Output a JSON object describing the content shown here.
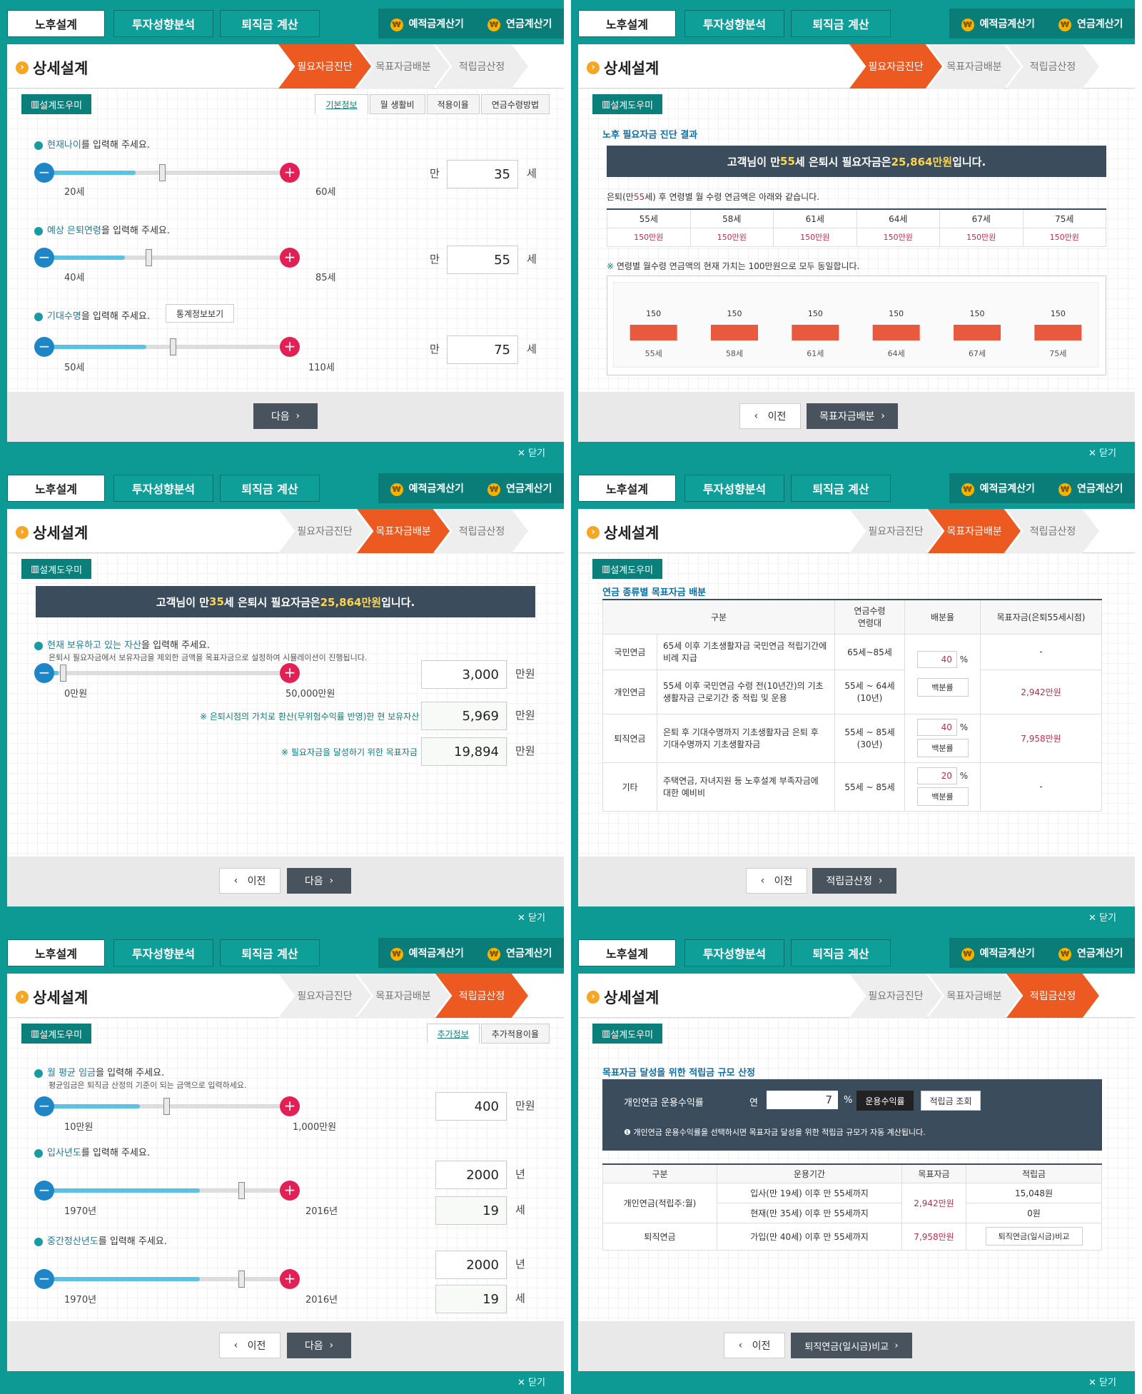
{
  "common": {
    "tabs": [
      "노후설계",
      "투자성향분석",
      "퇴직금 계산"
    ],
    "calc_deposit": "예적금계산기",
    "calc_pension": "연금계산기",
    "coin": "₩",
    "title": "상세설계",
    "steps": [
      "필요자금진단",
      "목표자금배분",
      "적립금산정"
    ],
    "helper": "설계도우미",
    "prev": "이전",
    "next": "다음",
    "close": "✕ 닫기",
    "colors": {
      "teal": "#0d9a94",
      "orange": "#ec5a22",
      "navy": "#3b4d5c"
    }
  },
  "p1": {
    "subtabs": [
      "기본정보",
      "월 생활비",
      "적용이율",
      "연금수령방법"
    ],
    "q1": {
      "hl": "현재나이",
      "rest": "를 입력해 주세요.",
      "min": "20세",
      "max": "60세",
      "pre": "만",
      "value": "35",
      "unit": "세",
      "level": 0.38
    },
    "q2": {
      "hl": "예상 은퇴연령",
      "rest": "을 입력해 주세요.",
      "min": "40세",
      "max": "85세",
      "pre": "만",
      "value": "55",
      "unit": "세",
      "level": 0.33
    },
    "q3": {
      "hl": "기대수명",
      "rest": "을 입력해 주세요.",
      "btn": "통계정보보기",
      "min": "50세",
      "max": "110세",
      "pre": "만",
      "value": "75",
      "unit": "세",
      "level": 0.42
    }
  },
  "p2": {
    "title": "노후 필요자금 진단 결과",
    "banner_a": "고객님이 만 ",
    "banner_age": "55",
    "banner_b": " 세 은퇴시 필요자금은 ",
    "banner_amt": "25,864만원",
    "banner_c": "입니다.",
    "desc_a": "은퇴(만",
    "desc_age": "55",
    "desc_b": "세) 후 연령별 월 수령 연금액은 아래와 같습니다.",
    "ages": [
      "55세",
      "58세",
      "61세",
      "64세",
      "67세",
      "75세"
    ],
    "amounts": [
      "150만원",
      "150만원",
      "150만원",
      "150만원",
      "150만원",
      "150만원"
    ],
    "note": "연령별 월수령 연금액의 현재 가치는 100만원으로 모두 동일합니다.",
    "next_btn": "목표자금배분"
  },
  "chart_data": {
    "type": "bar",
    "categories": [
      "55세",
      "58세",
      "61세",
      "64세",
      "67세",
      "75세"
    ],
    "values": [
      150,
      150,
      150,
      150,
      150,
      150
    ],
    "data_labels": [
      "150",
      "150",
      "150",
      "150",
      "150",
      "150"
    ]
  },
  "p3": {
    "banner_a": "고객님이 만 ",
    "banner_age": "35",
    "banner_b": "세 은퇴시 필요자금은 ",
    "banner_amt": "25,864만원",
    "banner_c": " 입니다.",
    "q_hl": "현재 보유하고 있는 자산",
    "q_rest": "을 입력해 주세요.",
    "q_sub": "은퇴시 필요자금에서 보유자금을 제외한 금액을 목표자금으로 설정하여 시뮬레이션이 진행됩니다.",
    "min": "0만원",
    "max": "50,000만원",
    "value": "3,000",
    "unit": "만원",
    "level": 0.06,
    "line2_label": "※ 은퇴시점의 가치로 환산(무위험수익률 반영)한 현 보유자산",
    "line2_value": "5,969",
    "line2_unit": "만원",
    "line3_label": "※ 필요자금을 달성하기 위한 목표자금",
    "line3_value": "19,894",
    "line3_unit": "만원"
  },
  "p4": {
    "title": "연금 종류별 목표자금 배분",
    "headers": [
      "구분",
      "연금수령\n연령대",
      "배분율",
      "목표자금(은퇴55세시점)"
    ],
    "rows": [
      {
        "type": "국민연금",
        "desc": "65세 이후 기초생활자금 국민연금 적립기간에 비례 지급",
        "age": "65세~85세",
        "rate": "40",
        "target": "-"
      },
      {
        "type": "개인연금",
        "desc": "55세 이후 국민연금 수령 전(10년간)의 기초생활자금 근로기간 중 적립 및 운용",
        "age": "55세 ~ 64세\n(10년)",
        "rate": "",
        "target": "2,942만원"
      },
      {
        "type": "퇴직연금",
        "desc": "은퇴 후 기대수명까지 기초생활자금 은퇴 후 기대수명까지 기초생활자금",
        "age": "55세 ~ 85세\n(30년)",
        "rate": "40",
        "target": "7,958만원"
      },
      {
        "type": "기타",
        "desc": "주택연금, 자녀지원 등 노후설계 부족자금에 대한 예비비",
        "age": "55세 ~ 85세",
        "rate": "20",
        "target": "-"
      }
    ],
    "pct": "%",
    "rate_btn": "백분률",
    "next_btn": "적립금산정"
  },
  "p5": {
    "subtabs": [
      "추가정보",
      "추가적용이율"
    ],
    "q1": {
      "hl": "월 평균 임금",
      "rest": "을 입력해 주세요.",
      "sub": "평균임금은 퇴직금 산정의 기준이 되는 금액으로 입력하세요.",
      "min": "10만원",
      "max": "1,000만원",
      "value": "400",
      "unit": "만원",
      "level": 0.4
    },
    "q2": {
      "hl": "입사년도",
      "rest": "를 입력해 주세요.",
      "min": "1970년",
      "max": "2016년",
      "value": "2000",
      "unit": "년",
      "value2": "19",
      "unit2": "세",
      "level": 0.65
    },
    "q3": {
      "hl": "중간정산년도",
      "rest": "를 입력해 주세요.",
      "min": "1970년",
      "max": "2016년",
      "value": "2000",
      "unit": "년",
      "value2": "19",
      "unit2": "세",
      "level": 0.65
    }
  },
  "p6": {
    "title": "목표자금 달성을 위한 적립금 규모 산정",
    "label": "개인연금 운용수익률",
    "year": "연",
    "value": "7",
    "pct": "%",
    "btn_rate": "운용수익률",
    "btn_view": "적립금 조회",
    "note": "개인연금 운용수익률을 선택하시면 목표자금 달성을 위한 적립금 규모가 자동 계산됩니다.",
    "headers": [
      "구분",
      "운용기간",
      "목표자금",
      "적립금"
    ],
    "r1_type": "개인연금(적립주:월)",
    "r1_p1": "입사(만 19세) 이후 만 55세까지",
    "r1_p2": "현재(만 35세) 이후 만 55세까지",
    "r1_target": "2,942만원",
    "r1_v1": "15,048원",
    "r1_v2": "0원",
    "r2_type": "퇴직연금",
    "r2_p": "가입(만 40세) 이후 만 55세까지",
    "r2_target": "7,958만원",
    "r2_btn": "퇴직연금(일시금)비교",
    "next_btn": "퇴직연금(일시금)비교"
  }
}
